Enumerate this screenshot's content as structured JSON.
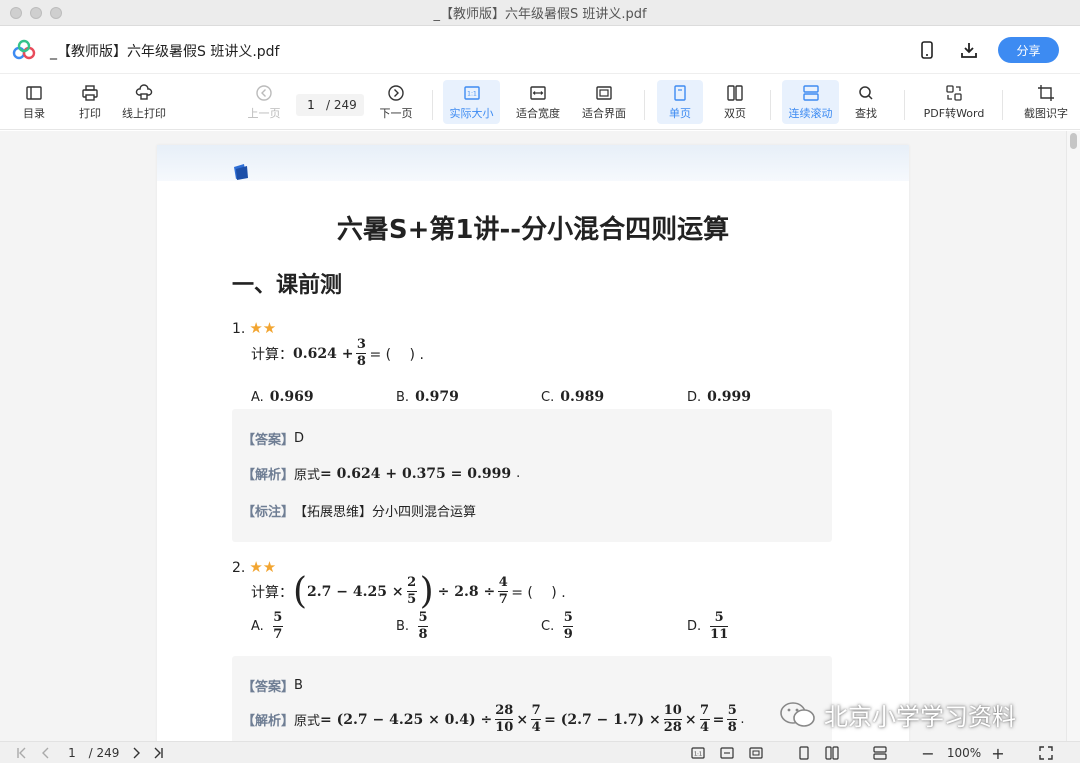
{
  "window": {
    "title": "_【教师版】六年级暑假S 班讲义.pdf"
  },
  "header": {
    "filename": "_【教师版】六年级暑假S 班讲义.pdf",
    "share_label": "分享"
  },
  "toolbar": {
    "toc": "目录",
    "print": "打印",
    "online_print": "线上打印",
    "prev_page": "上一页",
    "current_page": "1",
    "total_pages": "/ 249",
    "next_page": "下一页",
    "actual_size": "实际大小",
    "fit_width": "适合宽度",
    "fit_page": "适合界面",
    "single_page": "单页",
    "double_page": "双页",
    "continuous_scroll": "连续滚动",
    "find": "查找",
    "pdf_to_word": "PDF转Word",
    "ocr": "截图识字",
    "actual_size_icon_text": "1:1"
  },
  "document": {
    "title": "六暑S+第1讲--分小混合四则运算",
    "section": "一、课前测",
    "q1": {
      "number": "1.",
      "stars": "★★",
      "prompt": "计算：",
      "expr_a": "0.624 +",
      "frac_num": "3",
      "frac_den": "8",
      "expr_b": "= (　 ) .",
      "options": [
        {
          "label": "A.",
          "value": "0.969"
        },
        {
          "label": "B.",
          "value": "0.979"
        },
        {
          "label": "C.",
          "value": "0.989"
        },
        {
          "label": "D.",
          "value": "0.999"
        }
      ],
      "answer_tag": "【答案】",
      "answer": "D",
      "analysis_tag": "【解析】",
      "analysis_prefix": "原式",
      "analysis": "= 0.624 + 0.375 = 0.999",
      "analysis_end": ".",
      "note_tag": "【标注】",
      "note": "【拓展思维】分小四则混合运算"
    },
    "q2": {
      "number": "2.",
      "stars": "★★",
      "prompt": "计算：",
      "paren_open": "(",
      "expr_a": "2.7 − 4.25 ×",
      "frac1_num": "2",
      "frac1_den": "5",
      "paren_close": ")",
      "expr_b": "÷ 2.8 ÷",
      "frac2_num": "4",
      "frac2_den": "7",
      "expr_c": "= (　 ) .",
      "options": [
        {
          "label": "A.",
          "num": "5",
          "den": "7"
        },
        {
          "label": "B.",
          "num": "5",
          "den": "8"
        },
        {
          "label": "C.",
          "num": "5",
          "den": "9"
        },
        {
          "label": "D.",
          "num": "5",
          "den": "11"
        }
      ],
      "answer_tag": "【答案】",
      "answer": "B",
      "analysis_tag": "【解析】",
      "analysis_prefix": "原式",
      "an_a": "= (2.7 − 4.25 × 0.4) ÷",
      "an_f1n": "28",
      "an_f1d": "10",
      "an_b": "×",
      "an_f2n": "7",
      "an_f2d": "4",
      "an_c": "= (2.7 − 1.7) ×",
      "an_f3n": "10",
      "an_f3d": "28",
      "an_d": "×",
      "an_f4n": "7",
      "an_f4d": "4",
      "an_e": "=",
      "an_f5n": "5",
      "an_f5d": "8",
      "an_end": "."
    }
  },
  "statusbar": {
    "current_page": "1",
    "total_pages": "/ 249",
    "zoom": "100%",
    "zoom_minus": "−",
    "zoom_plus": "+"
  },
  "watermark": {
    "text": "北京小学学习资料"
  },
  "colors": {
    "accent": "#3d8bf2",
    "stars": "#f2a531",
    "tag": "#6f7e94"
  }
}
